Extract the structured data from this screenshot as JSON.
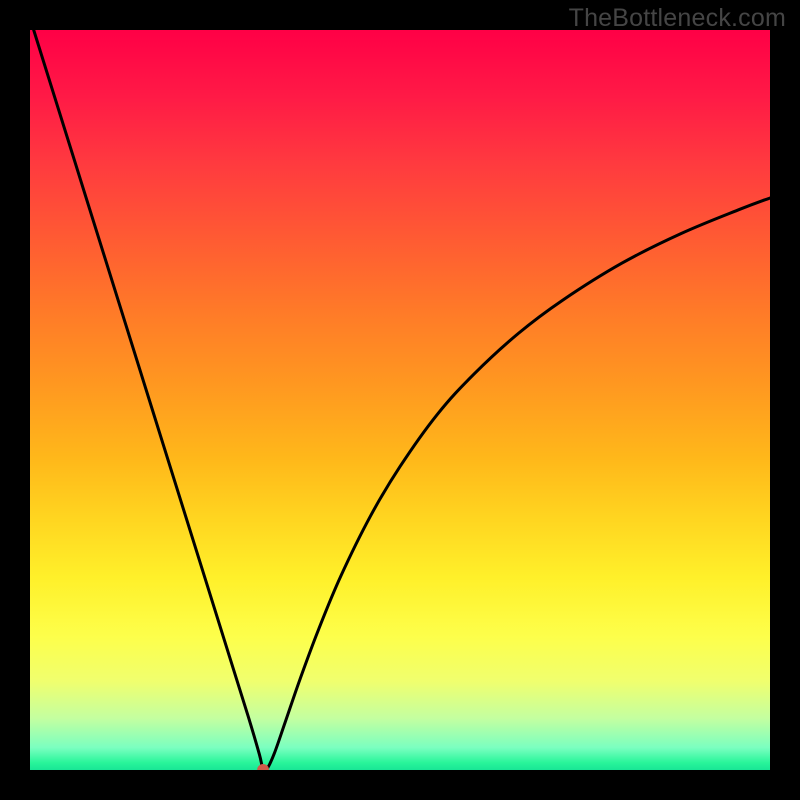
{
  "watermark": "TheBottleneck.com",
  "chart_data": {
    "type": "line",
    "title": "",
    "xlabel": "",
    "ylabel": "",
    "xlim": [
      0,
      100
    ],
    "ylim": [
      0,
      100
    ],
    "grid": false,
    "legend": false,
    "minimum_marker": {
      "x": 31.5,
      "y": 0,
      "color": "#d05a4a",
      "radius_px": 6
    },
    "series": [
      {
        "name": "bottleneck-curve",
        "color": "#000000",
        "x": [
          0.5,
          3,
          6,
          9,
          12,
          15,
          18,
          21,
          24,
          27,
          29.5,
          31,
          31.5,
          32,
          33,
          34.5,
          36.5,
          39,
          42,
          46,
          50,
          55,
          60,
          66,
          72,
          80,
          88,
          96,
          100
        ],
        "y": [
          100,
          92,
          82.4,
          72.8,
          63.2,
          53.6,
          44,
          34.4,
          24.8,
          15.2,
          7.2,
          2.1,
          0,
          0.1,
          2.2,
          6.5,
          12.3,
          19,
          26.2,
          34.3,
          41,
          48,
          53.5,
          59,
          63.5,
          68.5,
          72.5,
          75.8,
          77.3
        ]
      }
    ]
  }
}
